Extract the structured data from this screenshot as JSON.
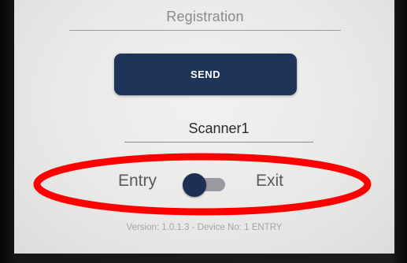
{
  "registration": {
    "label": "Registration"
  },
  "send_button": {
    "label": "SEND",
    "color": "#1e3458"
  },
  "scanner": {
    "value": "Scanner1"
  },
  "mode_toggle": {
    "left_label": "Entry",
    "right_label": "Exit",
    "selected": "Entry",
    "knob_color": "#1d2f52"
  },
  "footer": {
    "version_text": "Version: 1.0.1.3 - Device No: 1 ENTRY"
  },
  "annotation": {
    "ellipse_color": "#ff0000"
  }
}
